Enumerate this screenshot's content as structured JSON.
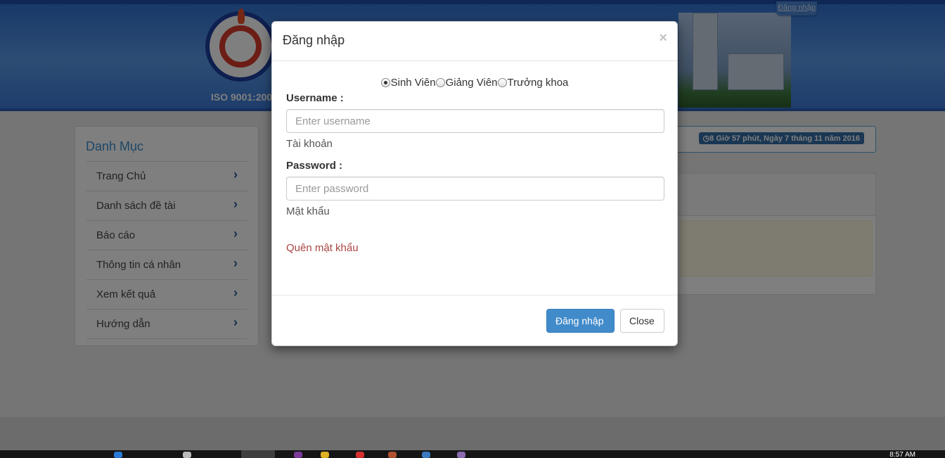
{
  "header": {
    "logo_text": "ISO 9001:200",
    "login_link": "Đăng nhập"
  },
  "sidebar": {
    "title": "Danh Mục",
    "items": [
      {
        "label": "Trang Chủ"
      },
      {
        "label": "Danh sách đề tài"
      },
      {
        "label": "Báo cáo"
      },
      {
        "label": "Thông tin cá nhân"
      },
      {
        "label": "Xem kết quả"
      },
      {
        "label": "Hướng dẫn"
      }
    ],
    "chevron": "›"
  },
  "clock": {
    "icon": "clock-icon",
    "text": "8 Giờ 57 phút, Ngày 7 tháng 11 năm 2016"
  },
  "modal": {
    "title": "Đăng nhập",
    "close_x": "×",
    "roles": [
      {
        "label": "Sinh Viên",
        "checked": true
      },
      {
        "label": "Giảng Viên",
        "checked": false
      },
      {
        "label": "Trưởng khoa",
        "checked": false
      }
    ],
    "username": {
      "label": "Username :",
      "placeholder": "Enter username",
      "value": "",
      "help": "Tài khoản"
    },
    "password": {
      "label": "Password :",
      "placeholder": "Enter password",
      "value": "",
      "help": "Mật khẩu"
    },
    "forgot": "Quên mật khẩu",
    "submit_label": "Đăng nhập",
    "close_label": "Close"
  },
  "taskbar": {
    "time": "8:57 AM"
  }
}
